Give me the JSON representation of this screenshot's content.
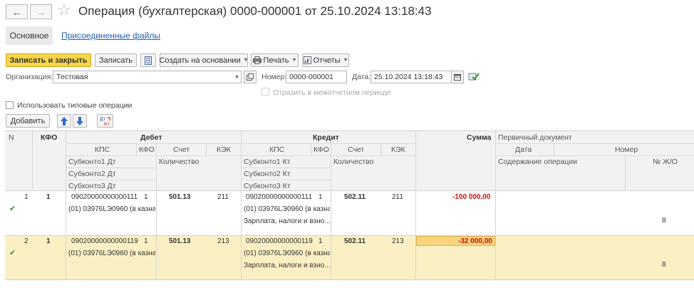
{
  "header": {
    "title": "Операция (бухгалтерская) 0000-000001 от 25.10.2024 13:18:43",
    "back_icon": "←",
    "forward_icon": "→",
    "star_icon": "☆"
  },
  "tabs": {
    "main": "Основное",
    "files": "Присоединенные файлы"
  },
  "toolbar": {
    "save_close": "Записать и закрыть",
    "save": "Записать",
    "create_based": "Создать на основании",
    "print": "Печать",
    "reports": "Отчеты"
  },
  "form": {
    "org_label": "Организация:",
    "org_value": "Тестовая",
    "number_label": "Номер:",
    "number_value": "0000-000001",
    "date_label": "Дата:",
    "date_value": "25.10.2024 13:18:43",
    "interbranch_label": "Отразить в межотчетном периоде",
    "typical_ops_label": "Использовать типовые операции",
    "add_button": "Добавить"
  },
  "table": {
    "headers": {
      "n": "N",
      "kfo": "КФО",
      "debit": "Дебет",
      "credit": "Кредит",
      "sum": "Сумма",
      "primary_doc": "Первичный документ",
      "kps": "КПС",
      "kfo2": "КФО",
      "account": "Счет",
      "kek": "КЭК",
      "date": "Дата",
      "number": "Номер",
      "sub1_dt": "Субконто1 Дт",
      "sub2_dt": "Субконто2 Дт",
      "sub3_dt": "Субконто3 Дт",
      "qty": "Количество",
      "sub1_kt": "Субконто1 Кт",
      "sub2_kt": "Субконто2 Кт",
      "sub3_kt": "Субконто3 Кт",
      "content": "Содержание операции",
      "journal_no": "№ Ж/О"
    },
    "rows": [
      {
        "n": "1",
        "kfo": "1",
        "dt_kps": "09020000000000111",
        "dt_kfo": "1",
        "dt_account": "501.13",
        "dt_kek": "211",
        "dt_sub1": "(01) 03976LЭ0960 (в казна...",
        "kt_kps": "09020000000000111",
        "kt_kfo": "1",
        "kt_account": "502.11",
        "kt_kek": "211",
        "kt_sub1": "(01) 03976LЭ0960 (в казна...",
        "kt_sub2": "Зарплата, налоги и взно...",
        "sum": "-100 000,00",
        "journal_no": "8"
      },
      {
        "n": "2",
        "kfo": "1",
        "dt_kps": "09020000000000119",
        "dt_kfo": "1",
        "dt_account": "501.13",
        "dt_kek": "213",
        "dt_sub1": "(01) 03976LЭ0960 (в казна...",
        "kt_kps": "09020000000000119",
        "kt_kfo": "1",
        "kt_account": "502.11",
        "kt_kek": "213",
        "kt_sub1": "(01) 03976LЭ0960 (в казна...",
        "kt_sub2": "Зарплата, налоги и взно...",
        "sum": "-32 000,00",
        "journal_no": "8"
      }
    ]
  }
}
